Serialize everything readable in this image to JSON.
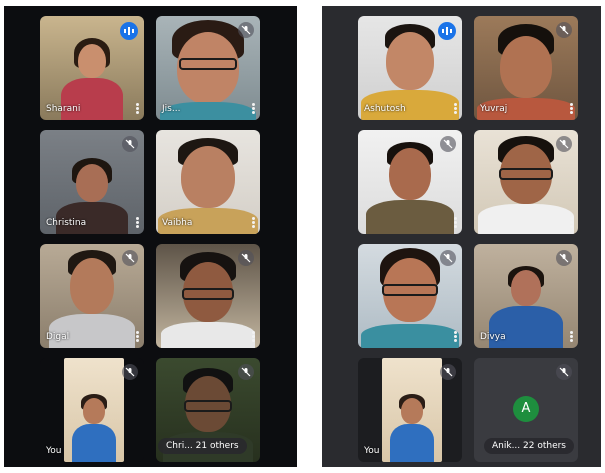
{
  "colors": {
    "screen1_bg": "#0c0d10",
    "screen2_bg": "#2a2b2f",
    "speaking_badge": "#1a73e8",
    "avatar_green": "#1e8e3e"
  },
  "icons": {
    "muted": "mic-off-icon",
    "speaking": "speaking-indicator-icon",
    "menu": "more-vert-icon"
  },
  "screen1": {
    "tiles": [
      {
        "name": "Sharani"
      },
      {
        "name": "Jis..."
      },
      {
        "name": "Christina"
      },
      {
        "name": "Vaibha"
      },
      {
        "name": "Digal"
      },
      {
        "name": ""
      },
      {
        "name": "You"
      },
      {
        "name": ""
      }
    ],
    "others_label": "Chri... 21 others"
  },
  "screen2": {
    "tiles": [
      {
        "name": "Ashutosh"
      },
      {
        "name": "Yuvraj"
      },
      {
        "name": ""
      },
      {
        "name": ""
      },
      {
        "name": ""
      },
      {
        "name": "Divya"
      },
      {
        "name": "You"
      }
    ],
    "avatar_letter": "A",
    "others_label": "Anik... 22 others"
  }
}
